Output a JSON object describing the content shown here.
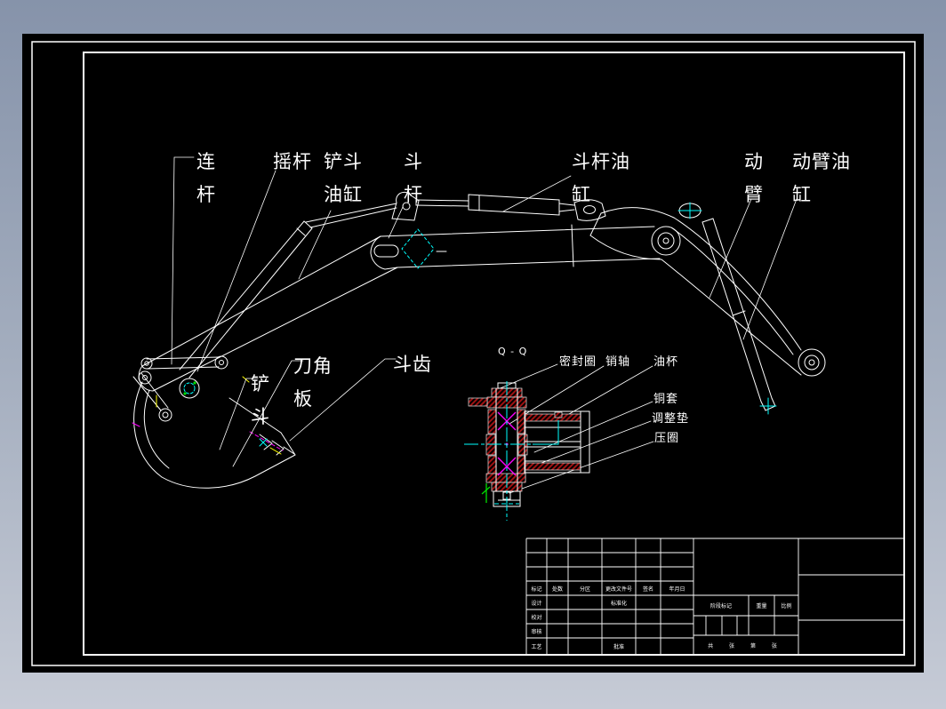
{
  "colors": {
    "margin_top": "#8693aa",
    "margin_bottom": "#c6cbd6",
    "canvas": "#000000",
    "line": "#ffffff",
    "centerline_cyan": "#00ffff",
    "bearing_magenta": "#ff00ff",
    "hatch_red": "#9e1212",
    "detail_green": "#00dd00",
    "detail_yellow": "#ffff00"
  },
  "labels": {
    "connecting_rod": "连\n杆",
    "rocker": "摇杆",
    "bucket_cylinder": "铲斗\n油缸",
    "arm": "斗\n杆",
    "arm_cylinder": "斗杆油\n缸",
    "boom": "动\n臂",
    "boom_cylinder": "动臂油\n缸",
    "bucket": "铲\n斗",
    "corner_blade": "刀角\n板",
    "bucket_teeth": "斗齿",
    "section_mark": "Q - Q",
    "seal_ring": "密封圈",
    "pin_shaft": "销轴",
    "oil_cup": "油杯",
    "copper_bushing": "铜套",
    "adjusting_shim": "调整垫",
    "press_ring": "压圈"
  },
  "title_block": {
    "rev_cols": [
      "标记",
      "处数",
      "分区",
      "更改文件号",
      "签名",
      "年月日"
    ],
    "row_design": "设计",
    "row_check": "校对",
    "row_audit": "审核",
    "row_process": "工艺",
    "standardization": "标准化",
    "approval": "批准",
    "stage_mark": "阶段标记",
    "weight": "重量",
    "scale": "比例",
    "sheets": "共 张 第 张"
  }
}
